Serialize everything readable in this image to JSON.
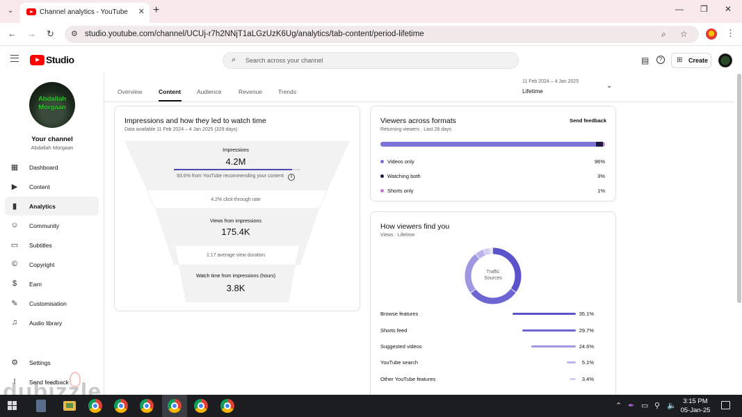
{
  "browser": {
    "tab_title": "Channel analytics - YouTube Studio",
    "url": "studio.youtube.com/channel/UCUj-r7h2NNjT1aLGzUzK6Ug/analytics/tab-content/period-lifetime",
    "icons": [
      "youtube-favicon",
      "close-icon",
      "plus-icon",
      "back-icon",
      "forward-icon",
      "reload-icon",
      "site-info-icon",
      "zoom-icon",
      "star-icon",
      "profile-icon",
      "menu-icon"
    ]
  },
  "header": {
    "logo_text": "Studio",
    "search_placeholder": "Search across your channel",
    "create_label": "Create"
  },
  "sidebar": {
    "avatar_text_line1": "Abdallah",
    "avatar_text_line2": "Morgaan",
    "channel_label": "Your channel",
    "channel_name": "Abdallah Morgaan",
    "items": [
      {
        "label": "Dashboard",
        "icon": "dashboard-icon"
      },
      {
        "label": "Content",
        "icon": "content-icon"
      },
      {
        "label": "Analytics",
        "icon": "analytics-icon",
        "active": true
      },
      {
        "label": "Community",
        "icon": "community-icon"
      },
      {
        "label": "Subtitles",
        "icon": "subtitles-icon"
      },
      {
        "label": "Copyright",
        "icon": "copyright-icon"
      },
      {
        "label": "Earn",
        "icon": "earn-icon"
      },
      {
        "label": "Customisation",
        "icon": "customisation-icon"
      },
      {
        "label": "Audio library",
        "icon": "audio-library-icon"
      },
      {
        "label": "Settings",
        "icon": "settings-icon"
      },
      {
        "label": "Send feedback",
        "icon": "feedback-icon"
      }
    ]
  },
  "tabs": {
    "items": [
      "Overview",
      "Content",
      "Audience",
      "Revenue",
      "Trends"
    ],
    "active": "Content"
  },
  "period": {
    "range": "11 Feb 2024 – 4 Jan 2025",
    "label": "Lifetime"
  },
  "impressions_card": {
    "title": "Impressions and how they led to watch time",
    "subtitle": "Data available 11 Feb 2024 – 4 Jan 2025 (329 days)",
    "impressions_label": "Impressions",
    "impressions_value": "4.2M",
    "recommended_note": "93.6% from YouTube recommending your content",
    "recommended_fraction": 0.936,
    "ctr_note": "4.2% click-through rate",
    "views_label": "Views from impressions",
    "views_value": "175.4K",
    "avd_note": "1:17 average view duration",
    "watch_label": "Watch time from impressions (hours)",
    "watch_value": "3.8K"
  },
  "formats_card": {
    "title": "Viewers across formats",
    "subtitle": "Returning viewers · Last 28 days",
    "feedback_label": "Send feedback",
    "rows": [
      {
        "label": "Videos only",
        "value": "96%",
        "pct": 96,
        "color": "#7b73d8"
      },
      {
        "label": "Watching both",
        "value": "3%",
        "pct": 3,
        "color": "#1f1a3d"
      },
      {
        "label": "Shorts only",
        "value": "1%",
        "pct": 1,
        "color": "#c27ad9"
      }
    ]
  },
  "traffic_card": {
    "title": "How viewers find you",
    "subtitle": "Views · Lifetime",
    "donut_label_line1": "Traffic",
    "donut_label_line2": "Sources",
    "sources": [
      {
        "label": "Browse features",
        "value": "35.1%",
        "pct": 35.1,
        "color": "#5b53c9"
      },
      {
        "label": "Shorts feed",
        "value": "29.7%",
        "pct": 29.7,
        "color": "#6d65d1"
      },
      {
        "label": "Suggested videos",
        "value": "24.6%",
        "pct": 24.6,
        "color": "#9e98e0"
      },
      {
        "label": "YouTube search",
        "value": "5.1%",
        "pct": 5.1,
        "color": "#b9b5ea"
      },
      {
        "label": "Other YouTube features",
        "value": "3.4%",
        "pct": 3.4,
        "color": "#d3d0f2"
      }
    ]
  },
  "taskbar": {
    "time": "3:15 PM",
    "date": "05-Jan-25"
  },
  "watermark": "dubizzle"
}
